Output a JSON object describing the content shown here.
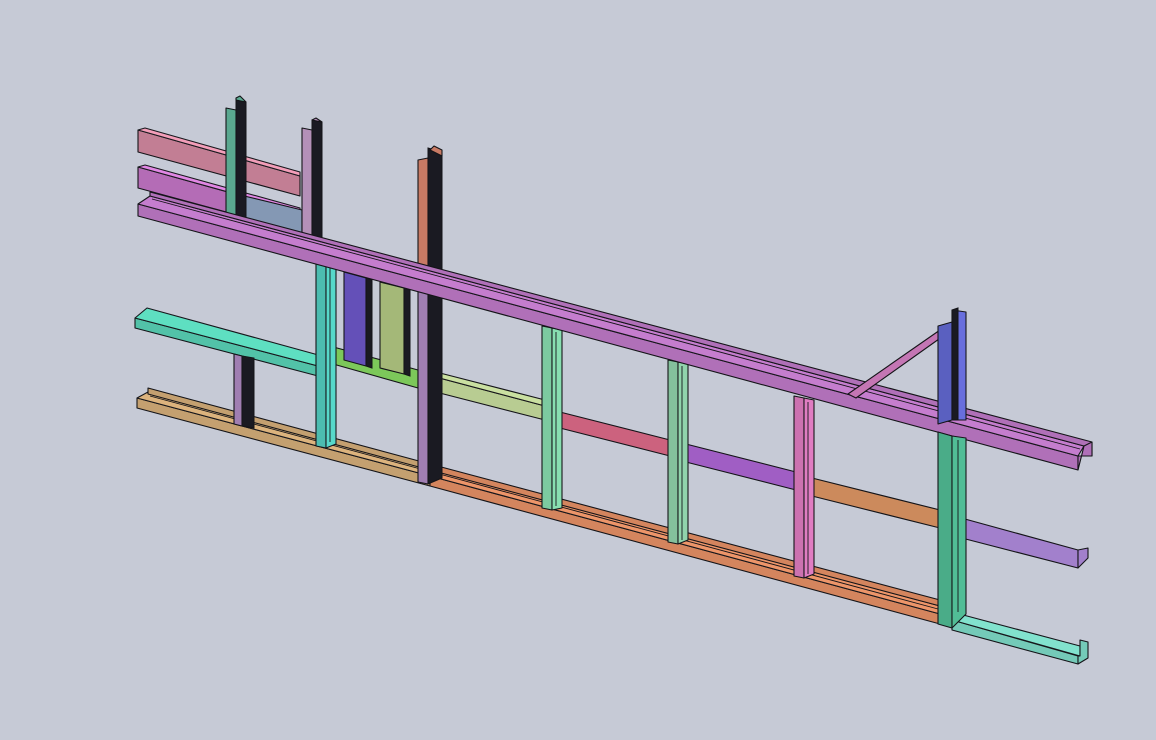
{
  "viewport": {
    "background": "#c6cad6"
  },
  "model": {
    "member_colors": {
      "top_track": "#b070b8",
      "top_plate_1": "#c27e94",
      "top_plate_2": "#b46cb6",
      "mid_left_rail": "#52c2a8",
      "bottom_track_left": "#c4a070",
      "bottom_track_right": "#d4855e",
      "right_mid_rail": "#a280cc",
      "right_low_rail": "#74cab8",
      "stud_green": "#5aa890",
      "stud_cyan": "#4cbcb0",
      "stud_lavender": "#a07eb2",
      "stud_salmon": "#c87a64",
      "stud_purple": "#b490b8",
      "stud_mint": "#7ccaa0",
      "stud_lightgreen": "#84c09c",
      "stud_pink": "#cc72b0",
      "stud_teal": "#4aac88",
      "stud_blue": "#5a60c0",
      "blocking_blue": "#8498b4",
      "blocking_tan": "#c8868a",
      "block_lime": "#7cc85a",
      "block_violet": "#6450b8",
      "block_olive": "#a4b878",
      "nogging_light": "#b8cc92",
      "nogging_red": "#cc627e",
      "nogging_purple": "#a05ec4",
      "nogging_orange": "#cc8a5c",
      "brace": "#c476b4"
    }
  }
}
